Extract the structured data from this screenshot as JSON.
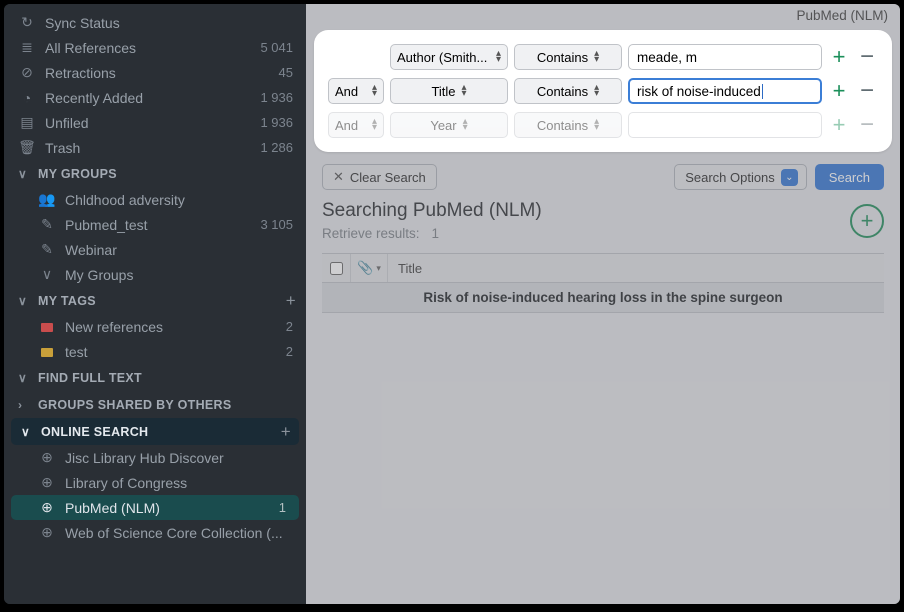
{
  "topbar": {
    "source": "PubMed (NLM)"
  },
  "sidebar": {
    "top": [
      {
        "icon": "↻",
        "label": "Sync Status",
        "count": ""
      },
      {
        "icon": "≣",
        "label": "All References",
        "count": "5 041"
      },
      {
        "icon": "⊘",
        "label": "Retractions",
        "count": "45"
      },
      {
        "icon": "◔",
        "label": "Recently Added",
        "count": "1 936"
      },
      {
        "icon": "▤",
        "label": "Unfiled",
        "count": "1 936"
      },
      {
        "icon": "🗑",
        "label": "Trash",
        "count": "1 286"
      }
    ],
    "groups_header": "MY GROUPS",
    "groups": [
      {
        "icon": "👥",
        "label": "Chldhood adversity",
        "count": ""
      },
      {
        "icon": "✎",
        "label": "Pubmed_test",
        "count": "3 105"
      },
      {
        "icon": "✎",
        "label": "Webinar",
        "count": ""
      },
      {
        "icon": "∨",
        "label": "My Groups",
        "count": ""
      }
    ],
    "tags_header": "MY TAGS",
    "tags": [
      {
        "color": "red",
        "label": "New references",
        "count": "2"
      },
      {
        "color": "yel",
        "label": "test",
        "count": "2"
      }
    ],
    "fft_header": "FIND FULL TEXT",
    "gso_header": "GROUPS SHARED BY OTHERS",
    "online_header": "ONLINE SEARCH",
    "online": [
      {
        "label": "Jisc Library Hub Discover",
        "count": ""
      },
      {
        "label": "Library of Congress",
        "count": ""
      },
      {
        "label": "PubMed (NLM)",
        "count": "1",
        "selected": true
      },
      {
        "label": "Web of Science Core Collection (...",
        "count": ""
      }
    ]
  },
  "search": {
    "row1": {
      "field": "Author (Smith...",
      "op": "Contains",
      "value": "meade, m"
    },
    "row2": {
      "bool": "And",
      "field": "Title",
      "op": "Contains",
      "value": "risk of noise-induced"
    },
    "row3": {
      "bool": "And",
      "field": "Year",
      "op": "Contains",
      "value": ""
    },
    "clear_label": "Clear Search",
    "options_label": "Search Options",
    "search_label": "Search"
  },
  "results": {
    "heading": "Searching PubMed (NLM)",
    "retrieve_label": "Retrieve results:",
    "retrieve_count": "1",
    "col_title": "Title",
    "rows": [
      {
        "title": "Risk of noise-induced hearing loss in the spine surgeon"
      }
    ]
  }
}
